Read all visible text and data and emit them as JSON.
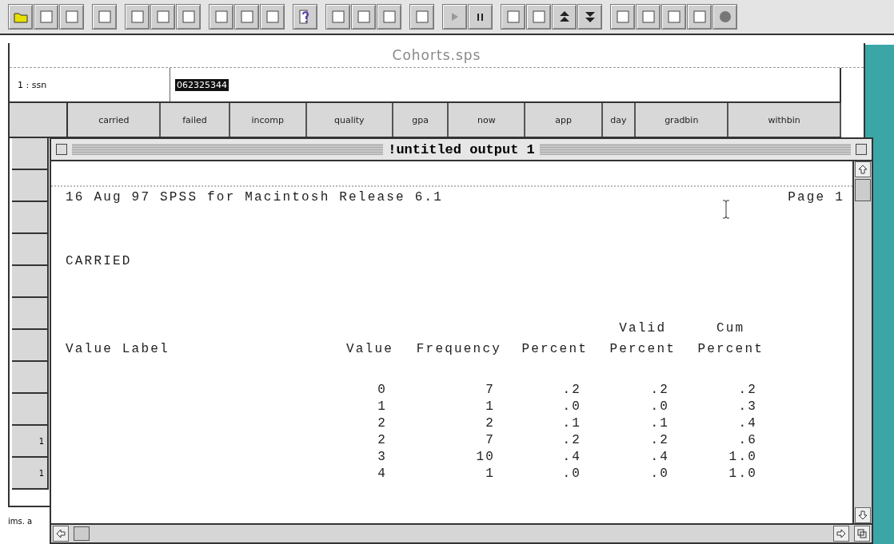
{
  "data_window": {
    "title": "Cohorts.sps",
    "cell_ref": "1 : ssn",
    "cell_value": "062325344",
    "columns": [
      "carried",
      "failed",
      "incomp",
      "quality",
      "gpa",
      "now",
      "app",
      "day",
      "gradbin",
      "withbin"
    ],
    "row_headers": [
      {
        "kind": "blank"
      },
      {
        "kind": "blank"
      },
      {
        "kind": "blank"
      },
      {
        "kind": "blank"
      },
      {
        "kind": "blank"
      },
      {
        "kind": "blank"
      },
      {
        "kind": "blank"
      },
      {
        "kind": "blank"
      },
      {
        "kind": "blank"
      },
      {
        "kind": "numbered",
        "label": "1"
      },
      {
        "kind": "numbered",
        "label": "1"
      }
    ],
    "status_text": "ims. a"
  },
  "output_window": {
    "title": "!untitled output 1",
    "header": "16 Aug 97 SPSS for Macintosh Release 6.1",
    "page": "Page 1",
    "variable": "CARRIED",
    "table": {
      "columns": [
        {
          "lines": [
            "Value Label"
          ]
        },
        {
          "lines": [
            "Value"
          ]
        },
        {
          "lines": [
            "Frequency"
          ]
        },
        {
          "lines": [
            "Percent"
          ]
        },
        {
          "lines": [
            "Valid",
            "Percent"
          ]
        },
        {
          "lines": [
            "Cum",
            "Percent"
          ]
        }
      ],
      "rows": [
        [
          "",
          "0",
          "7",
          ".2",
          ".2",
          ".2"
        ],
        [
          "",
          "1",
          "1",
          ".0",
          ".0",
          ".3"
        ],
        [
          "",
          "2",
          "2",
          ".1",
          ".1",
          ".4"
        ],
        [
          "",
          "2",
          "7",
          ".2",
          ".2",
          ".6"
        ],
        [
          "",
          "3",
          "10",
          ".4",
          ".4",
          "1.0"
        ],
        [
          "",
          "4",
          "1",
          ".0",
          ".0",
          "1.0"
        ]
      ]
    }
  }
}
